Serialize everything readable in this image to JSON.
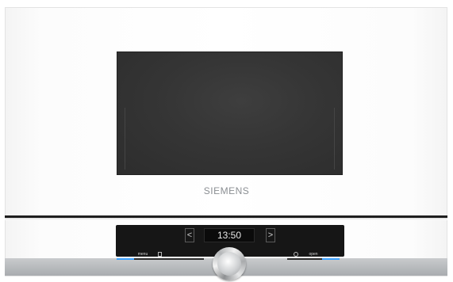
{
  "brand": "SIEMENS",
  "display": {
    "time": "13:50",
    "prev": "<",
    "next": ">"
  },
  "controls": {
    "left_accent_label": "",
    "menu_label": "menu",
    "info_icon": "info-icon",
    "timer_icon": "clock-icon",
    "open_label": "open",
    "right_accent_label": ""
  },
  "colors": {
    "accent": "#3aa0ff",
    "panel": "#161616",
    "body": "#ffffff"
  }
}
